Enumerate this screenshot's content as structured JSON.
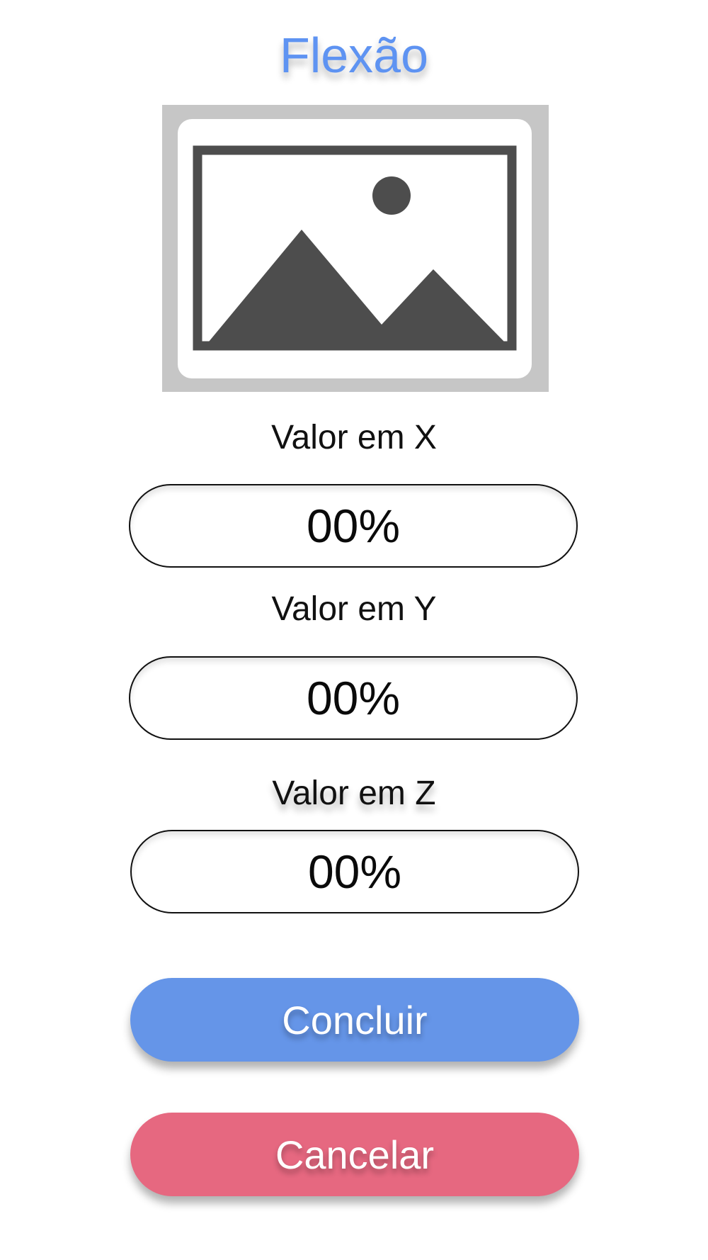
{
  "header": {
    "title": "Flexão"
  },
  "image": {
    "icon": "image-placeholder-icon"
  },
  "fields": {
    "x": {
      "label": "Valor em X",
      "value": "00%"
    },
    "y": {
      "label": "Valor em Y",
      "value": "00%"
    },
    "z": {
      "label": "Valor em Z",
      "value": "00%"
    }
  },
  "actions": {
    "confirm_label": "Concluir",
    "cancel_label": "Cancelar"
  },
  "colors": {
    "title": "#5e93f2",
    "confirm": "#6595e8",
    "cancel": "#e66880",
    "image_frame": "#c6c6c6",
    "image_glyph": "#4d4d4d"
  }
}
